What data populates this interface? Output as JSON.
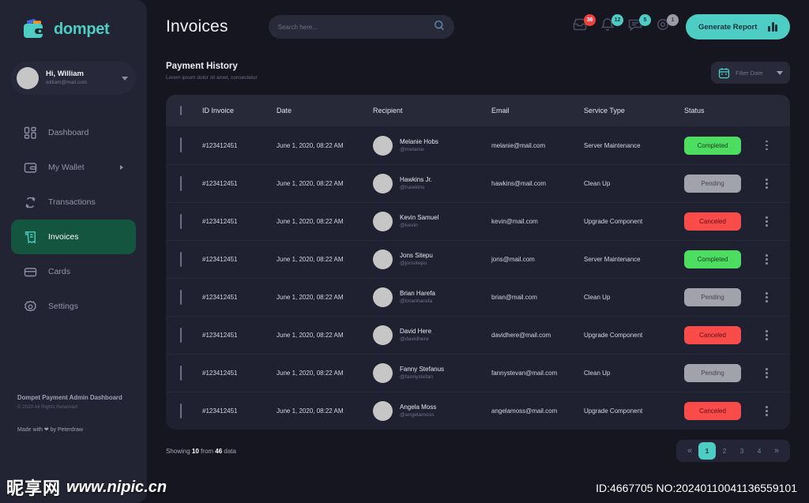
{
  "brand": {
    "name": "dompet",
    "logo_icon": "wallet-icon",
    "accent": "#4ecdc4",
    "logo_card_blue": "#3d6cd6",
    "logo_card_orange": "#f0932b"
  },
  "profile": {
    "greeting": "Hi, William",
    "email": "william@mail.com",
    "avatar": "user-avatar",
    "caret_icon": "chevron-down-icon"
  },
  "sidebar": {
    "items": [
      {
        "label": "Dashboard",
        "icon": "grid-icon",
        "active": false,
        "has_arrow": false
      },
      {
        "label": "My Wallet",
        "icon": "wallet-icon",
        "active": false,
        "has_arrow": true
      },
      {
        "label": "Transactions",
        "icon": "refresh-icon",
        "active": false,
        "has_arrow": false
      },
      {
        "label": "Invoices",
        "icon": "invoice-icon",
        "active": true,
        "has_arrow": false
      },
      {
        "label": "Cards",
        "icon": "credit-card-icon",
        "active": false,
        "has_arrow": false
      },
      {
        "label": "Settings",
        "icon": "gear-icon",
        "active": false,
        "has_arrow": false
      }
    ],
    "footer": {
      "title": "Dompet Payment Admin Dashboard",
      "copyright": "© 2020 All Rights Reserved",
      "made_with": "Made with ❤ by Peterdraw"
    }
  },
  "header": {
    "title": "Invoices",
    "search": {
      "placeholder": "Search here...",
      "value": "",
      "icon": "search-icon"
    },
    "notifications": [
      {
        "icon": "inbox-icon",
        "count": "36",
        "color": "red"
      },
      {
        "icon": "bell-icon",
        "count": "12",
        "color": "teal"
      },
      {
        "icon": "message-icon",
        "count": "5",
        "color": "teal"
      },
      {
        "icon": "gear-icon",
        "count": "1",
        "color": "gray"
      }
    ],
    "generate_report": {
      "label": "Generate Report",
      "icon": "bar-chart-icon"
    }
  },
  "section": {
    "title": "Payment History",
    "subtitle": "Lorem ipsum dolor sit amet, consectetur",
    "filter": {
      "label": "Filter Date",
      "icon": "calendar-icon",
      "caret_icon": "chevron-down-icon"
    }
  },
  "table": {
    "columns": [
      "ID Invoice",
      "Date",
      "Recipient",
      "Email",
      "Service Type",
      "Status"
    ],
    "select_all_checked": false,
    "rows": [
      {
        "checked": false,
        "id": "#123412451",
        "date": "June 1, 2020, 08:22 AM",
        "name": "Melanie Hobs",
        "handle": "@melanie",
        "email": "melanie@mail.com",
        "service": "Server Maintenance",
        "status": "Completed",
        "status_class": "completed"
      },
      {
        "checked": false,
        "id": "#123412451",
        "date": "June 1, 2020, 08:22 AM",
        "name": "Hawkins Jr.",
        "handle": "@hawkins",
        "email": "hawkins@mail.com",
        "service": "Clean Up",
        "status": "Pending",
        "status_class": "pending"
      },
      {
        "checked": false,
        "id": "#123412451",
        "date": "June 1, 2020, 08:22 AM",
        "name": "Kevin Samuel",
        "handle": "@kevin",
        "email": "kevin@mail.com",
        "service": "Upgrade Component",
        "status": "Canceled",
        "status_class": "canceled"
      },
      {
        "checked": false,
        "id": "#123412451",
        "date": "June 1, 2020, 08:22 AM",
        "name": "Jons Sitepu",
        "handle": "@jonsitepu",
        "email": "jons@mail.com",
        "service": "Server Maintenance",
        "status": "Completed",
        "status_class": "completed"
      },
      {
        "checked": false,
        "id": "#123412451",
        "date": "June 1, 2020, 08:22 AM",
        "name": "Brian Harefa",
        "handle": "@brianharefa",
        "email": "brian@mail.com",
        "service": "Clean Up",
        "status": "Pending",
        "status_class": "pending"
      },
      {
        "checked": false,
        "id": "#123412451",
        "date": "June 1, 2020, 08:22 AM",
        "name": "David Here",
        "handle": "@davidhere",
        "email": "davidhere@mail.com",
        "service": "Upgrade Component",
        "status": "Canceled",
        "status_class": "canceled"
      },
      {
        "checked": false,
        "id": "#123412451",
        "date": "June 1, 2020, 08:22 AM",
        "name": "Fanny Stefanus",
        "handle": "@fannystefan",
        "email": "fannystevan@mail.com",
        "service": "Clean Up",
        "status": "Pending",
        "status_class": "pending"
      },
      {
        "checked": false,
        "id": "#123412451",
        "date": "June 1, 2020, 08:22 AM",
        "name": "Angela Moss",
        "handle": "@angelamoss",
        "email": "angelamoss@mail.com",
        "service": "Upgrade Component",
        "status": "Canceled",
        "status_class": "canceled"
      }
    ]
  },
  "footer": {
    "showing_prefix": "Showing ",
    "showing_count": "10",
    "showing_middle": " from ",
    "showing_total": "46",
    "showing_suffix": " data",
    "pagination": {
      "prev_icon": "«",
      "next_icon": "»",
      "pages": [
        "1",
        "2",
        "3",
        "4"
      ],
      "active_page": "1"
    }
  },
  "watermark": {
    "chinese": "昵享网",
    "url": "www.nipic.cn",
    "id_overlay": "ID:4667705 NO:20240110041136559101"
  }
}
